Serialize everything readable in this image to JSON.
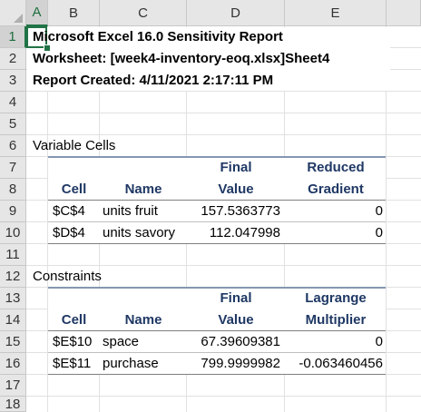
{
  "columns": [
    "A",
    "B",
    "C",
    "D",
    "E"
  ],
  "rows": [
    "1",
    "2",
    "3",
    "4",
    "5",
    "6",
    "7",
    "8",
    "9",
    "10",
    "11",
    "12",
    "13",
    "14",
    "15",
    "16",
    "17",
    "18"
  ],
  "report": {
    "title": "Microsoft Excel 16.0 Sensitivity Report",
    "worksheet": "Worksheet: [week4-inventory-eoq.xlsx]Sheet4",
    "created": "Report Created: 4/11/2021 2:17:11 PM"
  },
  "variable_cells": {
    "section_label": "Variable Cells",
    "headers": {
      "final_top": "Final",
      "reduced_top": "Reduced",
      "cell": "Cell",
      "name": "Name",
      "final_bottom": "Value",
      "reduced_bottom": "Gradient"
    },
    "rows": [
      {
        "cell": "$C$4",
        "name": "units fruit",
        "value": "157.5363773",
        "gradient": "0"
      },
      {
        "cell": "$D$4",
        "name": "units savory",
        "value": "112.047998",
        "gradient": "0"
      }
    ]
  },
  "constraints": {
    "section_label": "Constraints",
    "headers": {
      "final_top": "Final",
      "lagrange_top": "Lagrange",
      "cell": "Cell",
      "name": "Name",
      "final_bottom": "Value",
      "lagrange_bottom": "Multiplier"
    },
    "rows": [
      {
        "cell": "$E$10",
        "name": "space",
        "value": "67.39609381",
        "multiplier": "0"
      },
      {
        "cell": "$E$11",
        "name": "purchase",
        "value": "799.9999982",
        "multiplier": "-0.063460456"
      }
    ]
  },
  "colors": {
    "header_text": "#1f3864",
    "selection": "#217346"
  }
}
